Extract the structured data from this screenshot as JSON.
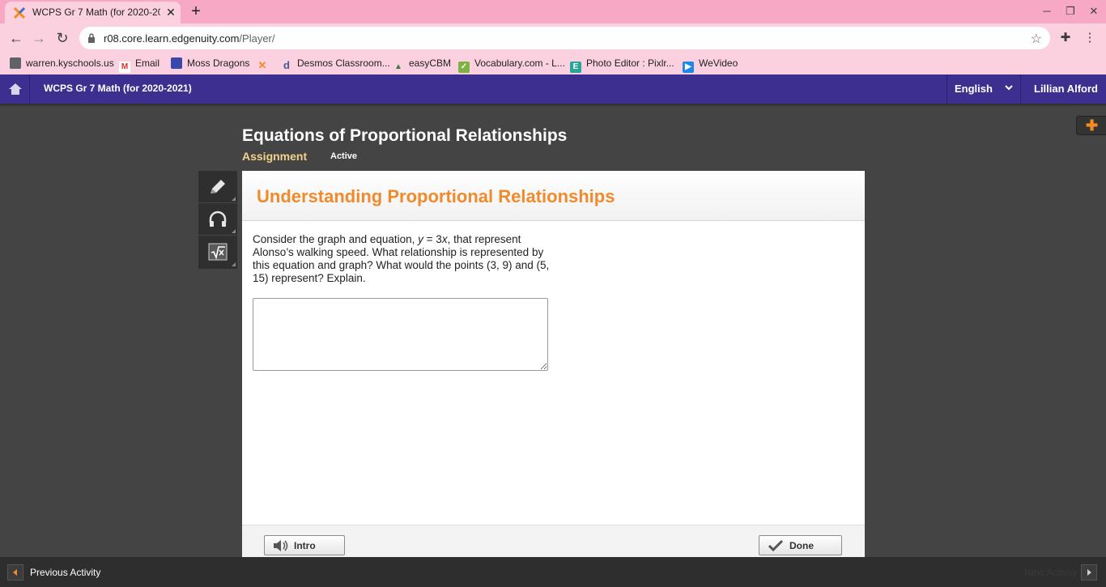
{
  "browser": {
    "tab_title": "WCPS Gr 7 Math (for 2020-2021)",
    "url_host": "r08.core.learn.edgenuity.com",
    "url_path": "/Player/",
    "bookmarks": [
      {
        "label": "warren.kyschools.us",
        "icon": "folder-icon"
      },
      {
        "label": "Email",
        "icon": "gmail-icon"
      },
      {
        "label": "Moss Dragons",
        "icon": "classroom-icon"
      },
      {
        "label": "",
        "icon": "edgenuity-icon"
      },
      {
        "label": "Desmos Classroom...",
        "icon": "desmos-icon"
      },
      {
        "label": "easyCBM",
        "icon": "easycbm-icon"
      },
      {
        "label": "Vocabulary.com - L...",
        "icon": "vocabulary-icon"
      },
      {
        "label": "Photo Editor : Pixlr...",
        "icon": "pixlr-icon"
      },
      {
        "label": "WeVideo",
        "icon": "wevideo-icon"
      }
    ]
  },
  "header": {
    "course_title": "WCPS Gr 7 Math (for 2020-2021)",
    "language": "English",
    "user_name": "Lillian Alford"
  },
  "lesson": {
    "title": "Equations of Proportional Relationships",
    "type": "Assignment",
    "status": "Active"
  },
  "activity": {
    "title": "Understanding Proportional Relationships",
    "question_part1": "Consider the graph and equation, ",
    "question_var_y": "y",
    "question_eq": " = 3",
    "question_var_x": "x",
    "question_part2": ", that represent Alonso’s walking speed. What relationship is represented by this equation and graph? What would the points (3, 9) and (5, 15) represent? Explain.",
    "answer_value": ""
  },
  "footer": {
    "intro_label": "Intro",
    "done_label": "Done"
  },
  "nav": {
    "previous_label": "Previous Activity",
    "next_label": "Next Activity"
  },
  "colors": {
    "app_bar": "#3d2f8f",
    "accent_orange": "#f08a2c",
    "assignment_gold": "#f2d28b",
    "browser_pink": "#f7a8c4"
  }
}
